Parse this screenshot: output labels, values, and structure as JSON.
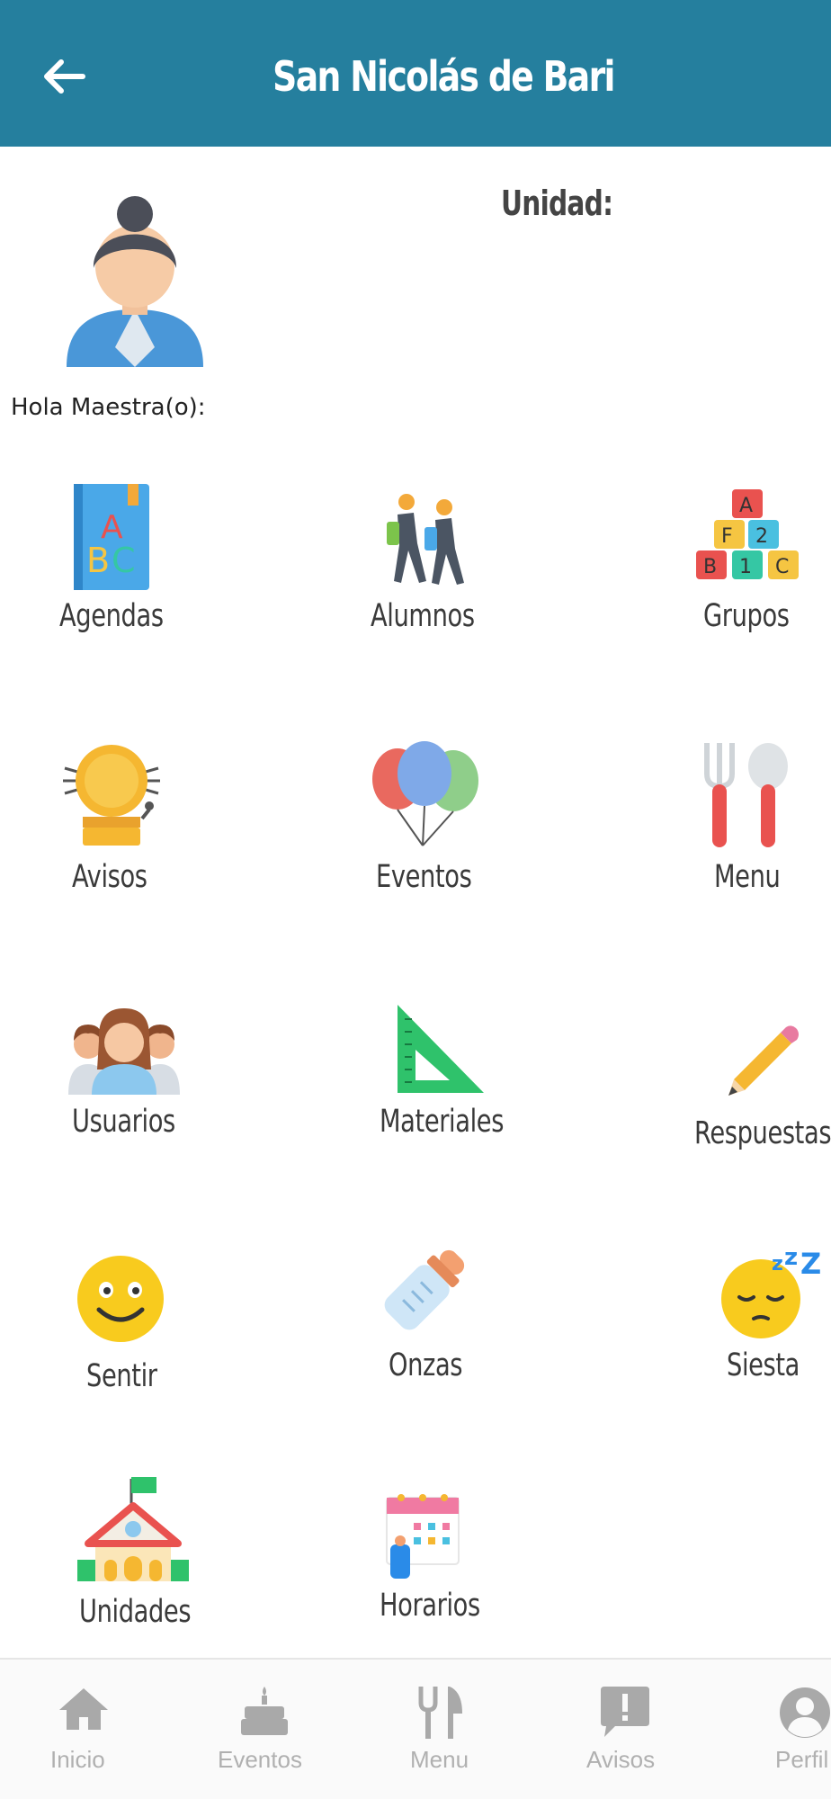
{
  "header": {
    "title": "San Nicolás de Bari",
    "back_icon": "arrow-left-icon",
    "color": "#257f9e"
  },
  "user": {
    "greeting": "Hola Maestra(o):",
    "avatar_icon": "teacher-avatar-icon"
  },
  "unit": {
    "label": "Unidad:"
  },
  "menu": [
    {
      "label": "Agendas",
      "icon": "abc-book-icon"
    },
    {
      "label": "Alumnos",
      "icon": "students-walking-icon"
    },
    {
      "label": "Grupos",
      "icon": "alphabet-blocks-icon"
    },
    {
      "label": "Avisos",
      "icon": "alarm-bell-icon"
    },
    {
      "label": "Eventos",
      "icon": "balloons-icon"
    },
    {
      "label": "Menu",
      "icon": "fork-spoon-icon"
    },
    {
      "label": "Usuarios",
      "icon": "users-group-icon"
    },
    {
      "label": "Materiales",
      "icon": "set-square-icon"
    },
    {
      "label": "Respuestas",
      "icon": "pencil-icon"
    },
    {
      "label": "Sentir",
      "icon": "smiley-face-icon"
    },
    {
      "label": "Onzas",
      "icon": "baby-bottle-icon"
    },
    {
      "label": "Siesta",
      "icon": "sleeping-face-icon"
    },
    {
      "label": "Unidades",
      "icon": "school-building-icon"
    },
    {
      "label": "Horarios",
      "icon": "schedule-calendar-icon"
    }
  ],
  "bottom_nav": [
    {
      "label": "Inicio",
      "icon": "home-icon"
    },
    {
      "label": "Eventos",
      "icon": "cake-icon"
    },
    {
      "label": "Menu",
      "icon": "utensils-icon"
    },
    {
      "label": "Avisos",
      "icon": "alert-message-icon"
    },
    {
      "label": "Perfil",
      "icon": "user-circle-icon"
    }
  ]
}
